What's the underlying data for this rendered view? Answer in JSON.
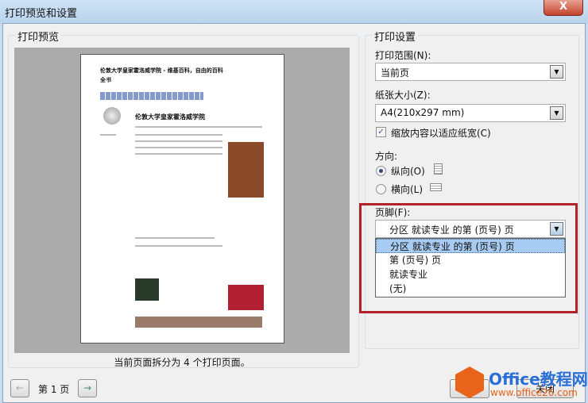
{
  "window": {
    "title": "打印预览和设置",
    "close_label": "X"
  },
  "preview": {
    "group_label": "打印预览",
    "page_title": "伦敦大学皇家霍洛威学院 - 维基百科，自由的百科全书",
    "article_heading": "伦敦大学皇家霍洛威学院",
    "caption": "当前页面拆分为 4 个打印页面。",
    "nav": {
      "prev_label": "←",
      "page_label": "第 1 页",
      "next_label": "→"
    }
  },
  "settings": {
    "group_label": "打印设置",
    "print_range": {
      "label": "打印范围(N):",
      "value": "当前页"
    },
    "paper_size": {
      "label": "纸张大小(Z):",
      "value": "A4(210x297 mm)"
    },
    "fit_width": {
      "label": "缩放内容以适应纸宽(C)",
      "checked": true
    },
    "orientation": {
      "label": "方向:",
      "portrait": "纵向(O)",
      "landscape": "横向(L)",
      "selected": "portrait"
    },
    "footer": {
      "label": "页脚(F):",
      "value": "分区 就读专业 的第 (页号) 页",
      "options": [
        "分区 就读专业 的第 (页号) 页",
        "第 (页号) 页",
        "就读专业",
        "(无)"
      ]
    }
  },
  "buttons": {
    "print": "打印",
    "close": "关闭"
  },
  "watermark": {
    "title": "Office教程网",
    "url": "www.office26.com"
  },
  "colors": {
    "highlight": "#b2222a",
    "selection": "#a8cbf1"
  }
}
